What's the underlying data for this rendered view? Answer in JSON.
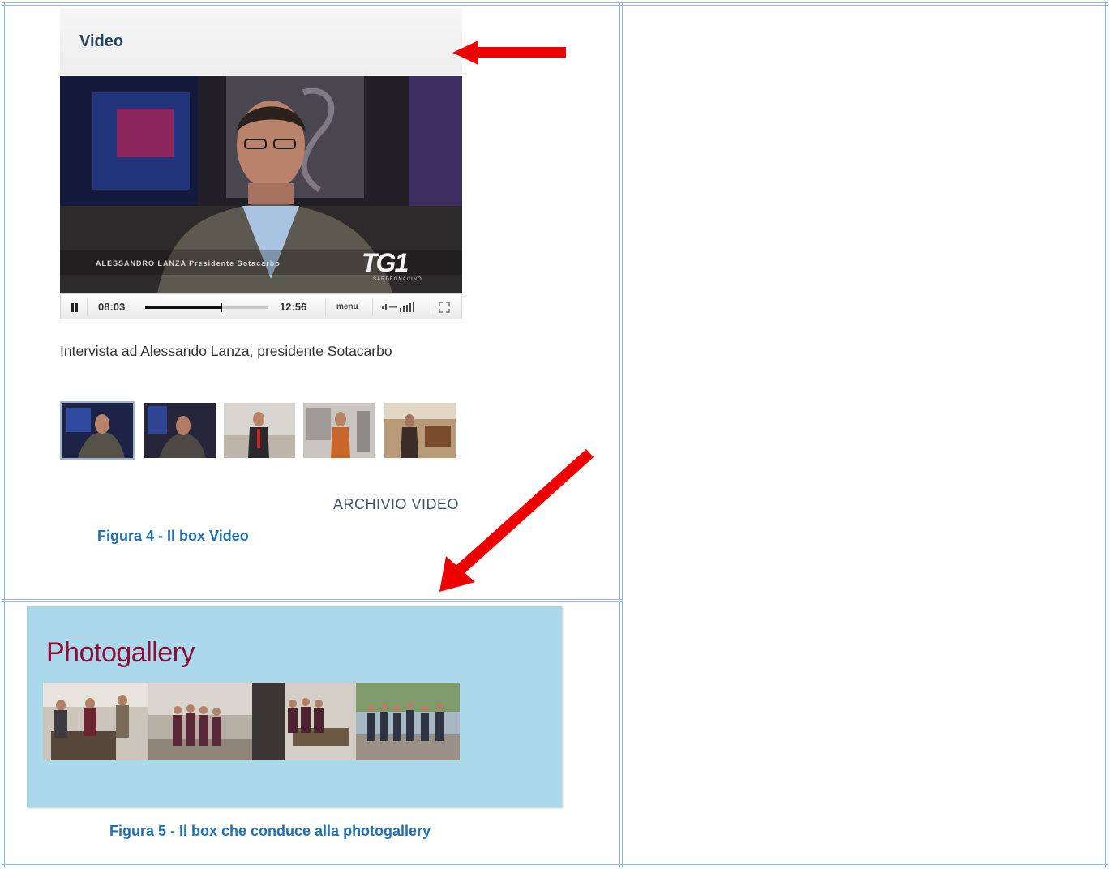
{
  "video_box": {
    "header": "Video",
    "player": {
      "elapsed": "08:03",
      "duration": "12:56",
      "progress": 0.62,
      "menu_label": "menu",
      "ticker": "ALESSANDRO LANZA  Presidente Sotacarbo",
      "logo": "TG1",
      "logo_sub": "SARDEGNA/UNO"
    },
    "caption": "Intervista ad Alessando Lanza, presidente Sotacarbo",
    "thumbnail_count": 5,
    "archive_link": "ARCHIVIO VIDEO"
  },
  "figure4_caption": "Figura 4 - Il box Video",
  "gallery_box": {
    "title": "Photogallery",
    "photo_count": 4
  },
  "figure5_caption": "Figura 5 - Il box che conduce alla photogallery",
  "colors": {
    "table_border": "#8eb4e3",
    "caption_blue": "#1f6fb2",
    "arrow_red": "#ee0000",
    "gallery_bg": "#abd8ea",
    "gallery_title": "#8a0f38"
  }
}
